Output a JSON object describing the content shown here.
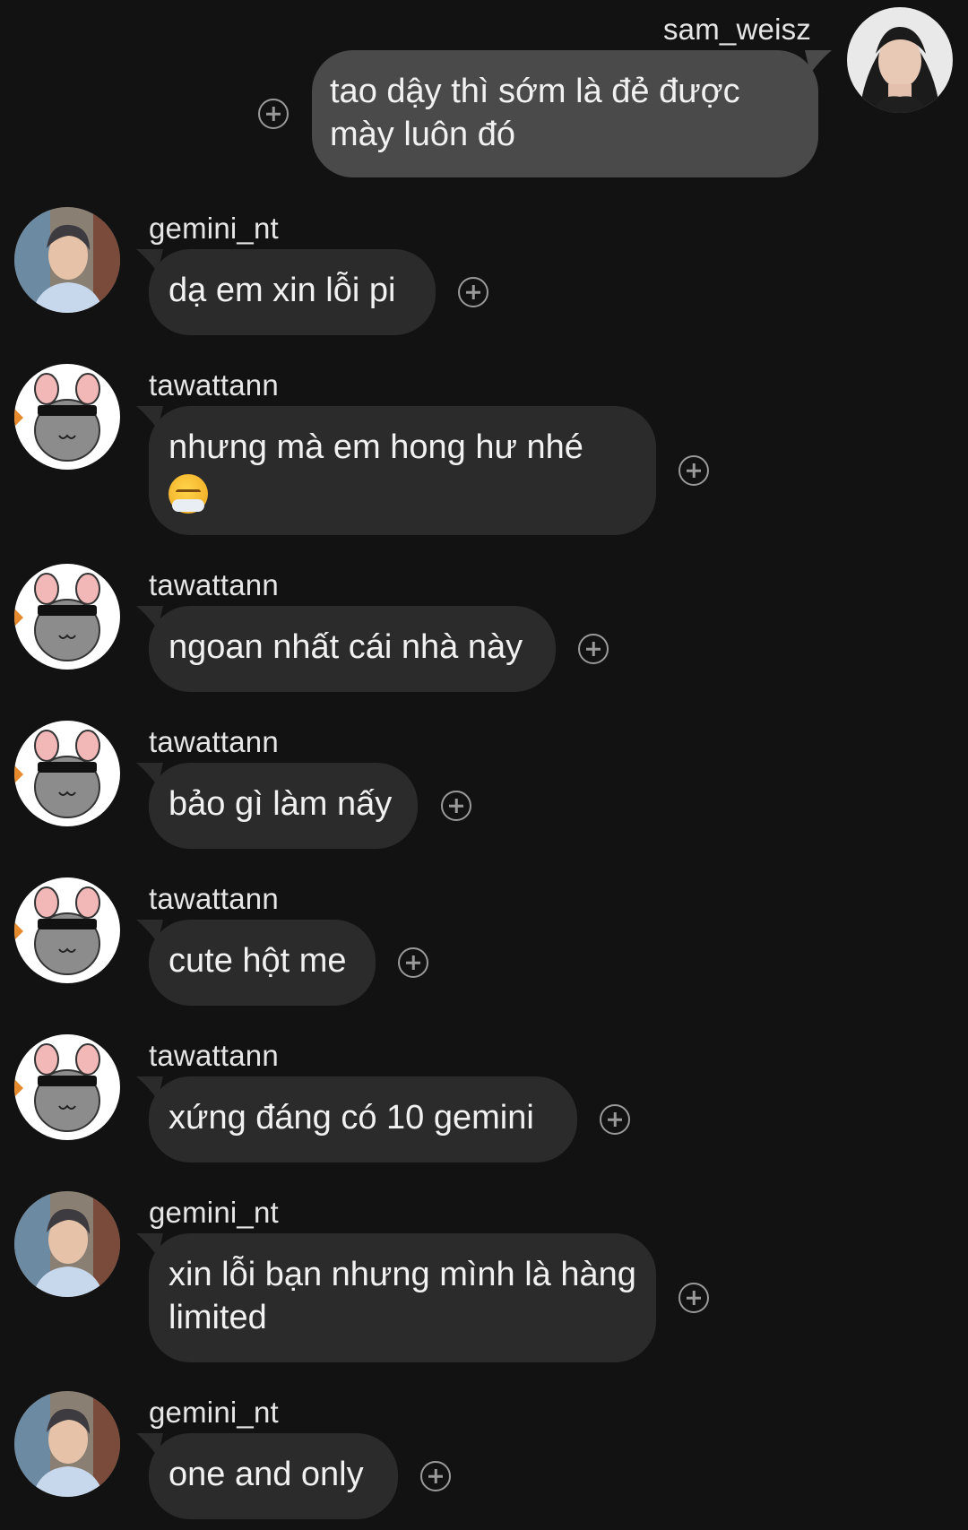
{
  "messages": [
    {
      "username": "sam_weisz",
      "text": "tao dậy thì sớm là đẻ được mày luôn đó",
      "direction": "out",
      "avatar": "avatar-sam_weisz"
    },
    {
      "username": "gemini_nt",
      "text": "dạ em xin lỗi pi",
      "direction": "in",
      "avatar": "avatar-gemini_nt"
    },
    {
      "username": "tawattann",
      "text": "nhưng mà em hong hư nhé",
      "emoji": "triumph-face-emoji",
      "direction": "in",
      "avatar": "avatar-tawattann"
    },
    {
      "username": "tawattann",
      "text": "ngoan nhất cái nhà này",
      "direction": "in",
      "avatar": "avatar-tawattann"
    },
    {
      "username": "tawattann",
      "text": "bảo gì làm nấy",
      "direction": "in",
      "avatar": "avatar-tawattann"
    },
    {
      "username": "tawattann",
      "text": "cute hột me",
      "direction": "in",
      "avatar": "avatar-tawattann"
    },
    {
      "username": "tawattann",
      "text": "xứng đáng có 10 gemini",
      "direction": "in",
      "avatar": "avatar-tawattann"
    },
    {
      "username": "gemini_nt",
      "text": "xin lỗi bạn nhưng mình là hàng limited",
      "direction": "in",
      "avatar": "avatar-gemini_nt"
    },
    {
      "username": "gemini_nt",
      "text": "one and only",
      "direction": "in",
      "avatar": "avatar-gemini_nt"
    }
  ],
  "colors": {
    "background": "#121212",
    "bubble_in": "#2b2b2b",
    "bubble_out": "#4a4a4a",
    "text": "#f1f1f1",
    "react_icon": "#9a9a9a"
  },
  "icons": {
    "react": "add-reaction-icon"
  }
}
